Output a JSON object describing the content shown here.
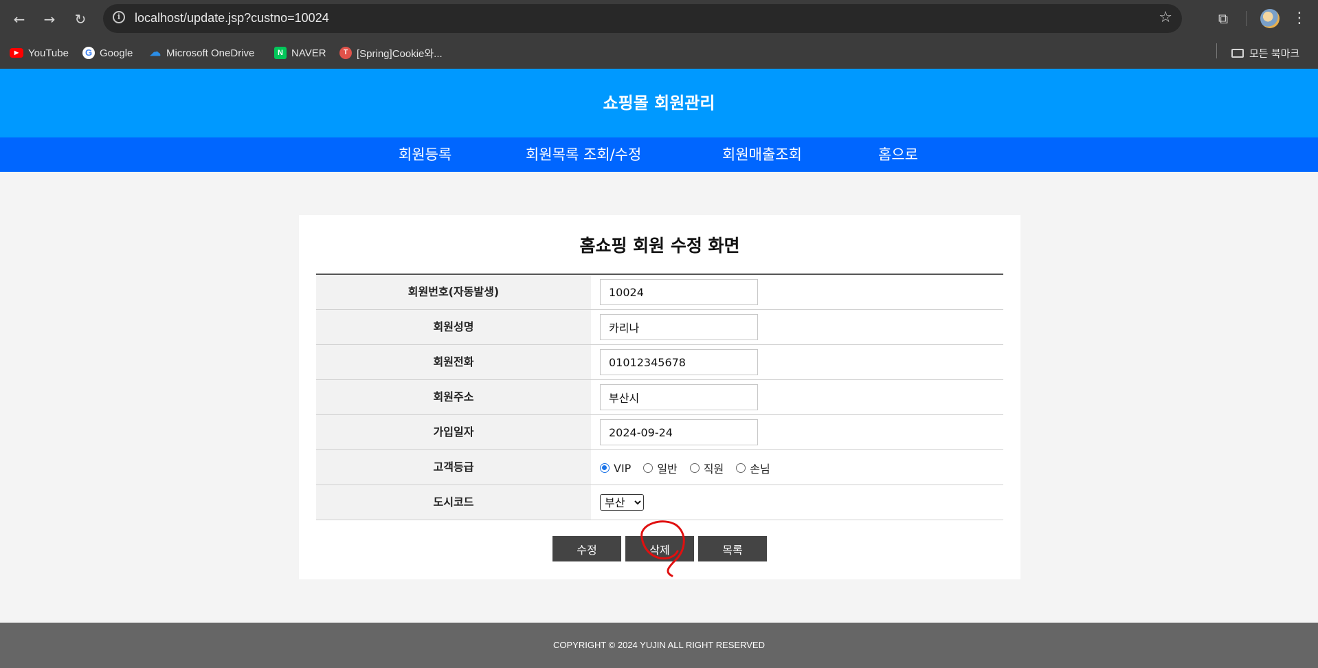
{
  "browser": {
    "url": "localhost/update.jsp?custno=10024",
    "bookmarks": [
      {
        "label": "YouTube",
        "icon": "youtube-icon"
      },
      {
        "label": "Google",
        "icon": "google-icon"
      },
      {
        "label": "Microsoft OneDrive",
        "icon": "onedrive-icon"
      },
      {
        "label": "NAVER",
        "icon": "naver-icon"
      },
      {
        "label": "[Spring]Cookie와...",
        "icon": "site-icon"
      }
    ],
    "all_bookmarks_label": "모든 북마크"
  },
  "header": {
    "title": "쇼핑몰 회원관리",
    "color": "#0099ff"
  },
  "nav": {
    "color": "#0066ff",
    "items": [
      "회원등록",
      "회원목록 조회/수정",
      "회원매출조회",
      "홈으로"
    ]
  },
  "form": {
    "title": "홈쇼핑 회원 수정 화면",
    "fields": {
      "custno": {
        "label": "회원번호(자동발생)",
        "value": "10024"
      },
      "name": {
        "label": "회원성명",
        "value": "카리나"
      },
      "phone": {
        "label": "회원전화",
        "value": "01012345678"
      },
      "address": {
        "label": "회원주소",
        "value": "부산시"
      },
      "joindate": {
        "label": "가입일자",
        "value": "2024-09-24"
      },
      "grade": {
        "label": "고객등급",
        "options": [
          "VIP",
          "일반",
          "직원",
          "손님"
        ],
        "selected": "VIP"
      },
      "city": {
        "label": "도시코드",
        "selected": "부산"
      }
    },
    "buttons": {
      "update": "수정",
      "delete": "삭제",
      "list": "목록"
    }
  },
  "footer": {
    "text": "COPYRIGHT © 2024 YUJIN ALL RIGHT RESERVED"
  }
}
